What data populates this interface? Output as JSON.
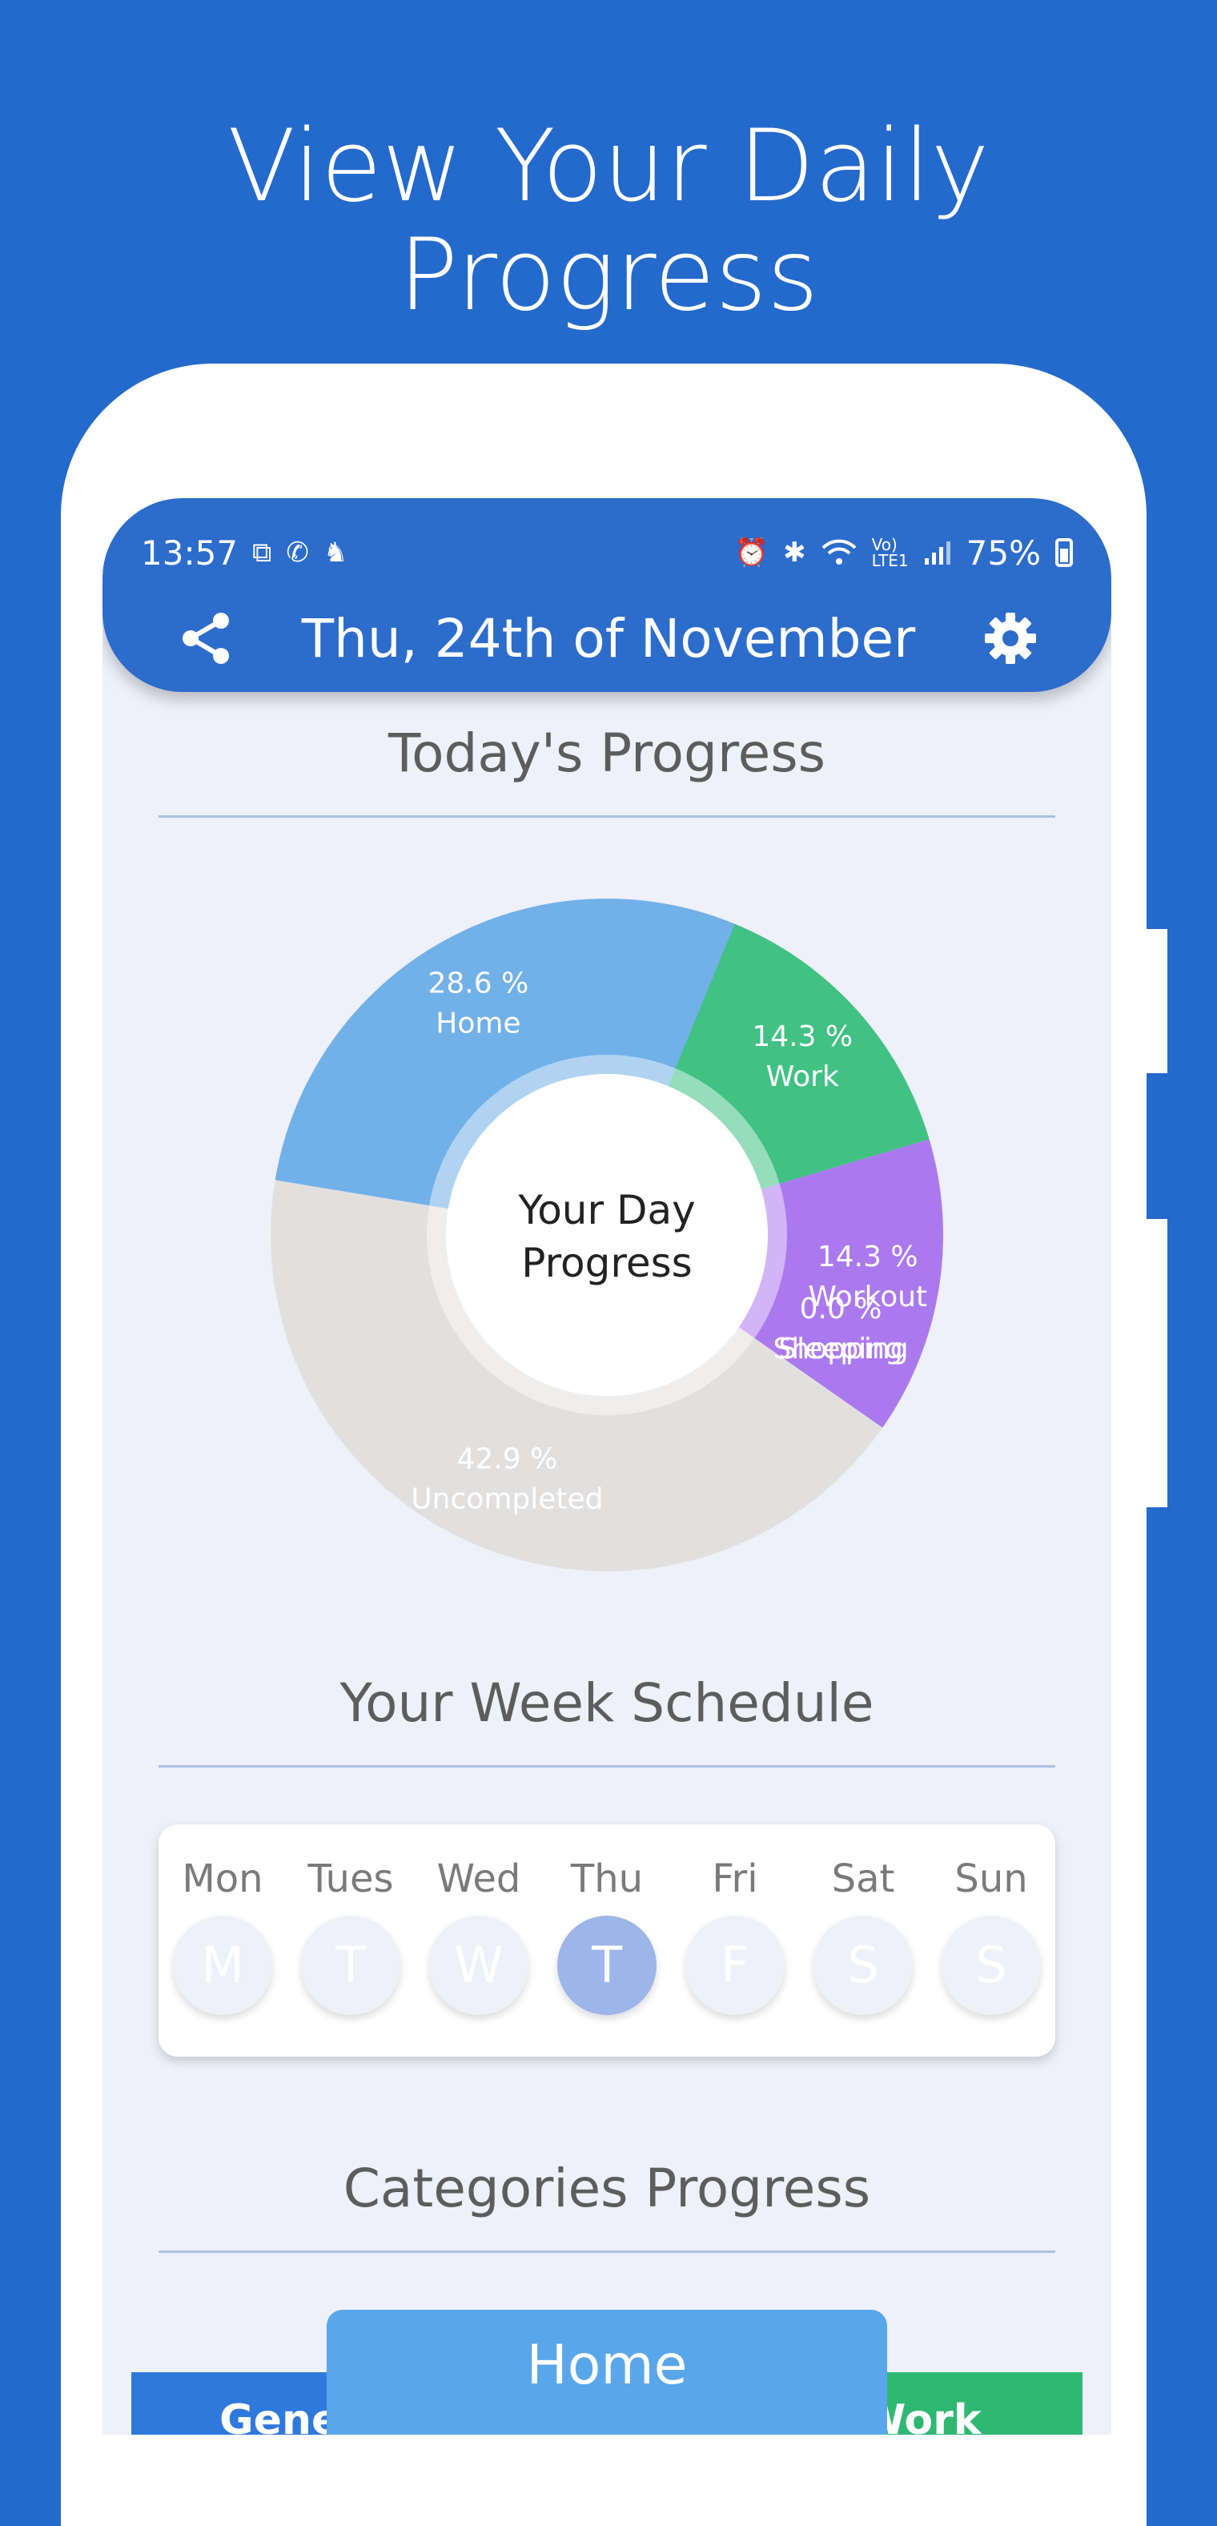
{
  "headline": {
    "line1": "View Your Daily",
    "line2": "Progress"
  },
  "status_bar": {
    "time": "13:57",
    "battery": "75%",
    "left_icons": [
      "screenshot-icon",
      "whatsapp-icon",
      "app-icon"
    ],
    "right_icons": [
      "alarm-icon",
      "bluetooth-icon",
      "wifi-icon",
      "volte-icon",
      "signal-icon"
    ]
  },
  "app_bar": {
    "date_title": "Thu, 24th of November",
    "share_icon": "share-icon",
    "settings_icon": "gear-icon"
  },
  "todays_progress": {
    "title": "Today's Progress",
    "center_line1": "Your Day",
    "center_line2": "Progress"
  },
  "chart_data": {
    "type": "pie",
    "title": "Today's Progress",
    "slices": [
      {
        "label": "Work",
        "percent_label": "14.3 %",
        "value": 14.3,
        "color": "#41c184"
      },
      {
        "label": "Workout",
        "percent_label": "14.3 %",
        "value": 14.3,
        "color": "#ab79ee"
      },
      {
        "label": "Sleeping",
        "percent_label": "0.0 %",
        "value": 0.0,
        "color": "#f2a3b5"
      },
      {
        "label": "Shopping",
        "percent_label": "",
        "value": 0.0,
        "color": "#f5c56b"
      },
      {
        "label": "Uncompleted",
        "percent_label": "42.9 %",
        "value": 42.9,
        "color": "#e2e0df"
      },
      {
        "label": "Home",
        "percent_label": "28.6 %",
        "value": 28.6,
        "color": "#72b0e8"
      }
    ]
  },
  "week_schedule": {
    "title": "Your Week Schedule",
    "days": [
      {
        "name": "Mon",
        "letter": "M",
        "active": false
      },
      {
        "name": "Tues",
        "letter": "T",
        "active": false
      },
      {
        "name": "Wed",
        "letter": "W",
        "active": false
      },
      {
        "name": "Thu",
        "letter": "T",
        "active": true
      },
      {
        "name": "Fri",
        "letter": "F",
        "active": false
      },
      {
        "name": "Sat",
        "letter": "S",
        "active": false
      },
      {
        "name": "Sun",
        "letter": "S",
        "active": false
      }
    ]
  },
  "categories": {
    "title": "Categories Progress",
    "tabs": [
      {
        "label": "General",
        "color": "#2f79dc"
      },
      {
        "label": "Home",
        "color": "#5aa6ea"
      },
      {
        "label": "Work",
        "color": "#2fb872"
      }
    ]
  }
}
